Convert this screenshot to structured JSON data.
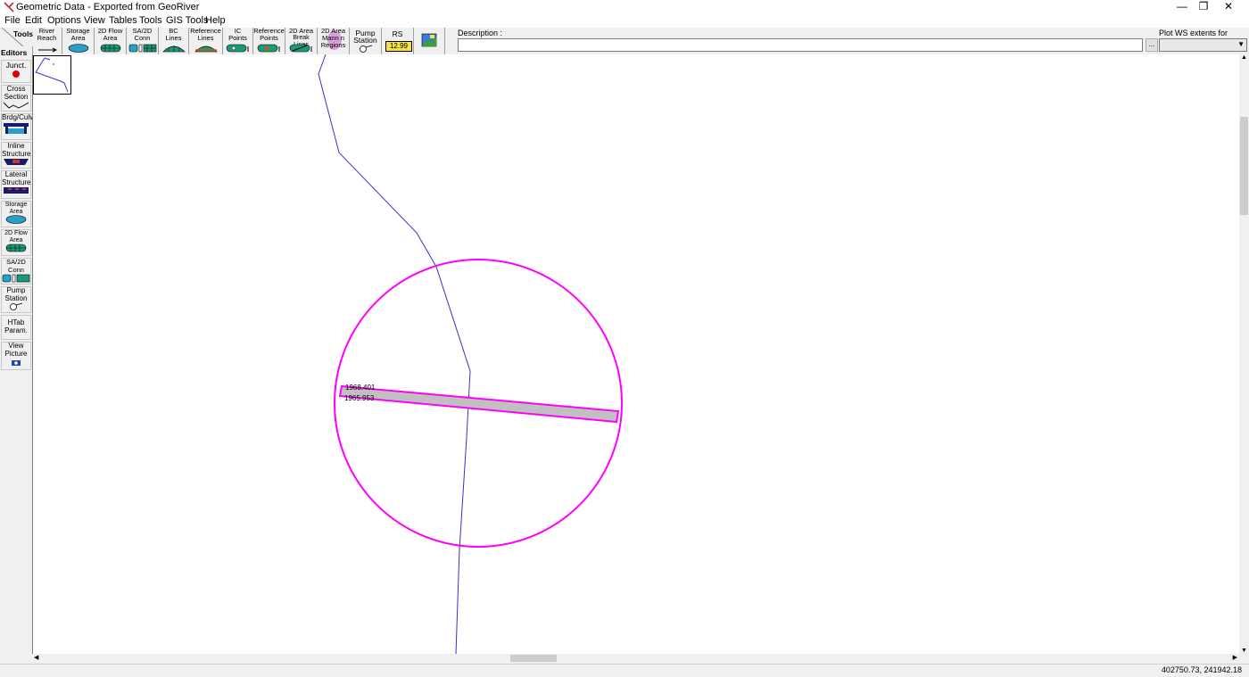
{
  "window": {
    "title": "Geometric Data - Exported from GeoRiver",
    "minimize": "—",
    "restore": "❐",
    "close": "✕"
  },
  "menu": [
    "File",
    "Edit",
    "Options",
    "View",
    "Tables",
    "Tools",
    "GIS Tools",
    "Help"
  ],
  "toolbar": {
    "tools_tab": "Tools",
    "buttons": [
      {
        "line1": "River",
        "line2": "Reach"
      },
      {
        "line1": "Storage",
        "line2": "Area"
      },
      {
        "line1": "2D Flow",
        "line2": "Area"
      },
      {
        "line1": "SA/2D",
        "line2": "Conn"
      },
      {
        "line1": "BC",
        "line2": "Lines"
      },
      {
        "line1": "Reference",
        "line2": "Lines"
      },
      {
        "line1": "IC",
        "line2": "Points"
      },
      {
        "line1": "Reference",
        "line2": "Points"
      },
      {
        "line1": "2D Area",
        "line2": "Break Lines"
      },
      {
        "line1": "2D Area",
        "line2": "Mann n",
        "line3": "Regions"
      },
      {
        "line1": "Pump",
        "line2": "Station"
      },
      {
        "line1": "RS",
        "line2": "12.99"
      }
    ],
    "description_label": "Description :",
    "description_value": "",
    "description_button": "...",
    "plot_ws_label": "Plot WS extents for Profile:",
    "plot_ws_value": ""
  },
  "editors": {
    "title": "Editors",
    "items": [
      {
        "line1": "Junct."
      },
      {
        "line1": "Cross",
        "line2": "Section"
      },
      {
        "line1": "Brdg/Culv"
      },
      {
        "line1": "Inline",
        "line2": "Structure"
      },
      {
        "line1": "Lateral",
        "line2": "Structure"
      },
      {
        "line1": "Storage",
        "line2": "Area"
      },
      {
        "line1": "2D Flow",
        "line2": "Area"
      },
      {
        "line1": "SA/2D",
        "line2": "Conn"
      },
      {
        "line1": "Pump",
        "line2": "Station"
      },
      {
        "line1": "HTab",
        "line2": "Param."
      },
      {
        "line1": "View",
        "line2": "Picture"
      }
    ]
  },
  "map": {
    "cross_section_labels": [
      "1968.401",
      "1965.953"
    ],
    "river_color": "#3333cc",
    "highlight_color": "#ff00ff",
    "cross_section_fill": "#c0c0c0"
  },
  "status": {
    "coordinates": "402750.73, 241942.18"
  },
  "colors": {
    "junction_red": "#e00000",
    "storage_cyan": "#2aa0c8",
    "flow_green": "#1a9a7a",
    "structure_navy": "#1a1a6a"
  }
}
